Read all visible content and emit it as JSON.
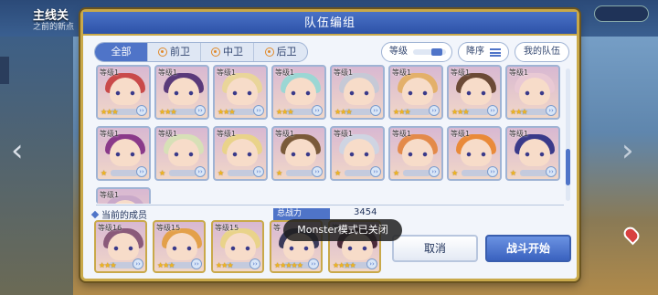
{
  "background": {
    "title": "主线关",
    "subtitle": "之前的新点"
  },
  "dialog": {
    "title": "队伍编组",
    "tabs": [
      "全部",
      "前卫",
      "中卫",
      "后卫"
    ],
    "sort_label": "等级",
    "order_label": "降序",
    "my_team_label": "我的队伍"
  },
  "roster": {
    "level_text": "等级1",
    "cards": [
      {
        "stars": "★★★",
        "hair": "#c94a4a"
      },
      {
        "stars": "★★★",
        "hair": "#5a3a7a"
      },
      {
        "stars": "★★★",
        "hair": "#e9d59a"
      },
      {
        "stars": "★★★",
        "hair": "#9bd7d4"
      },
      {
        "stars": "★★★",
        "hair": "#c6c9d6"
      },
      {
        "stars": "★★★",
        "hair": "#e3b06a"
      },
      {
        "stars": "★★★",
        "hair": "#6b4a36"
      },
      {
        "stars": "★★★",
        "hair": "#e9c9d4"
      },
      {
        "stars": "★",
        "hair": "#8a3a8a"
      },
      {
        "stars": "★",
        "hair": "#d7e0b7"
      },
      {
        "stars": "★",
        "hair": "#e9d38a"
      },
      {
        "stars": "★",
        "hair": "#7a5a3a"
      },
      {
        "stars": "★",
        "hair": "#cfd4e2"
      },
      {
        "stars": "★",
        "hair": "#e38a4a"
      },
      {
        "stars": "★",
        "hair": "#e98a3a"
      },
      {
        "stars": "★",
        "hair": "#3a3a8a"
      },
      {
        "stars": "",
        "hair": "#c9a9c9"
      }
    ]
  },
  "current_team": {
    "label": "当前的成员",
    "power_label": "总战力",
    "power_value": "3454",
    "members": [
      {
        "level": "等级16",
        "stars": "★★★",
        "hair": "#8a5a7a"
      },
      {
        "level": "等级15",
        "stars": "★★★",
        "hair": "#e3a04a"
      },
      {
        "level": "等级15",
        "stars": "★★★",
        "hair": "#e9d38a"
      },
      {
        "level": "等",
        "stars": "★★★★★",
        "hair": "#3a3a5a"
      },
      {
        "level": "等",
        "stars": "★★★★",
        "hair": "#4a2a3a"
      }
    ]
  },
  "buttons": {
    "cancel": "取消",
    "start": "战斗开始"
  },
  "toast": "Monster模式已关闭"
}
